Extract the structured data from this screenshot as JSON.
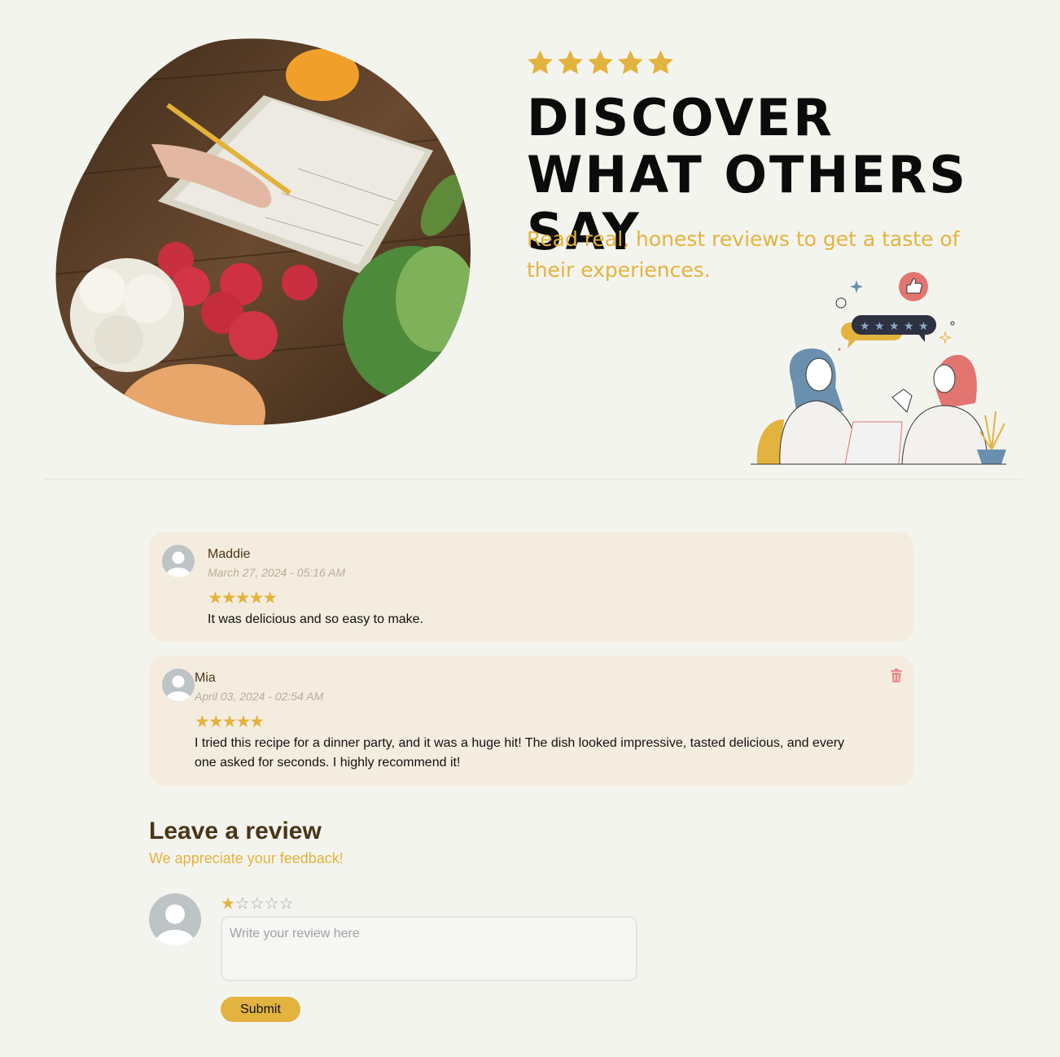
{
  "hero": {
    "rating_stars": 5,
    "title": "DISCOVER WHAT OTHERS SAY",
    "subtitle": "Read real, honest reviews to get a taste of their experiences.",
    "photo_icon": "recipe-notebook-vegetables-photo",
    "illustration_icon": "people-reviewing-illustration"
  },
  "reviews": [
    {
      "name": "Maddie",
      "date": "March 27, 2024 - 05:16 AM",
      "rating": 5,
      "stars": "★★★★★",
      "text": "It was delicious and so easy to make.",
      "deletable": false
    },
    {
      "name": "Mia",
      "date": "April 03, 2024 - 02:54 AM",
      "rating": 5,
      "stars": "★★★★★",
      "text": "I tried this recipe for a dinner party, and it was a huge hit! The dish looked impressive, tasted delicious, and every one asked for seconds. I highly recommend it!",
      "deletable": true,
      "delete_icon": "trash-icon"
    }
  ],
  "leave_review": {
    "title": "Leave a review",
    "subtitle": "We appreciate your feedback!",
    "selected_rating": 1,
    "max_rating": 5,
    "placeholder": "Write your review here",
    "value": "",
    "submit_label": "Submit"
  },
  "colors": {
    "background": "#f4f4ee",
    "accent": "#e3b33f",
    "card": "#f4eddf",
    "heading": "#4a3518",
    "delete": "#e88a8a"
  }
}
